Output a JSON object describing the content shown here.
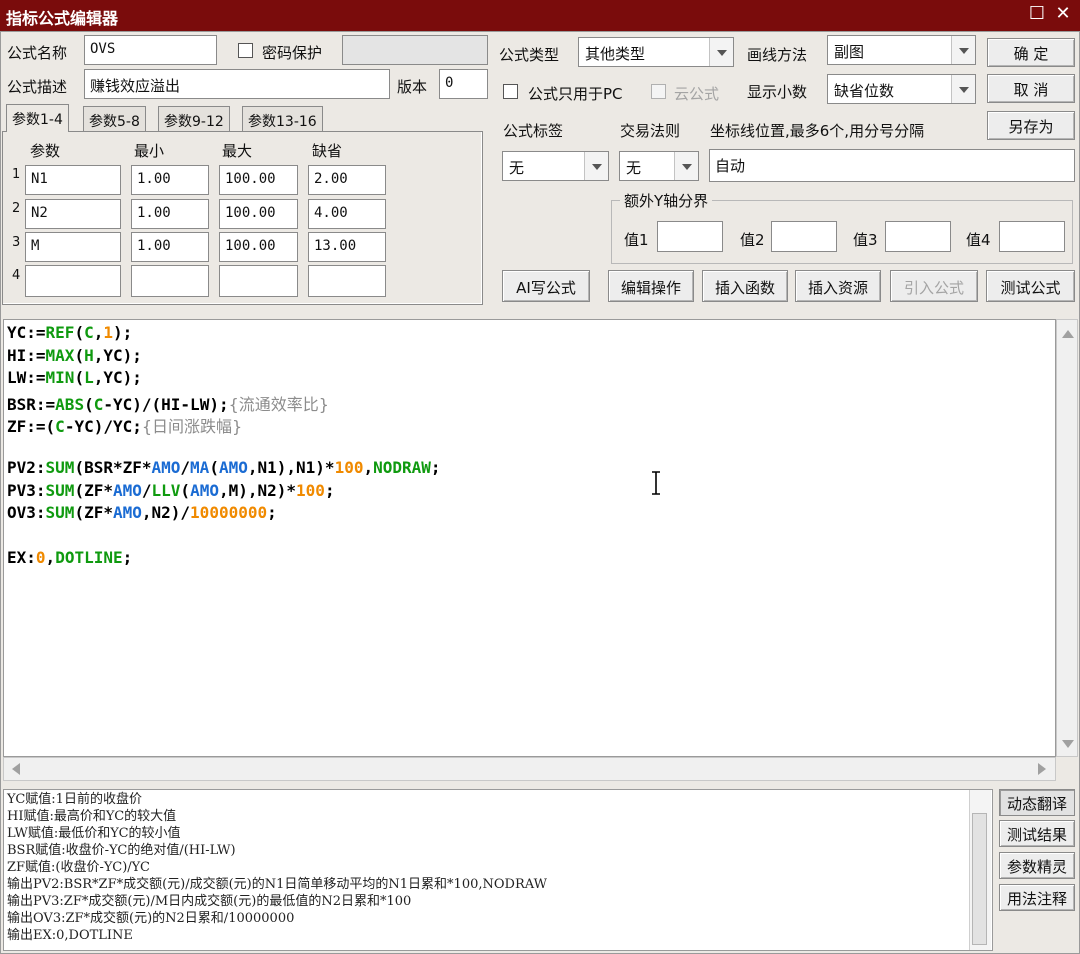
{
  "window": {
    "title": "指标公式编辑器",
    "restore_glyph": "☐",
    "close_glyph": "✕"
  },
  "form": {
    "name_label": "公式名称",
    "name_value": "OVS",
    "password_label": "密码保护",
    "desc_label": "公式描述",
    "desc_value": "赚钱效应溢出",
    "version_label": "版本",
    "version_value": "0",
    "type_label": "公式类型",
    "type_value": "其他类型",
    "draw_label": "画线方法",
    "draw_value": "副图",
    "pc_only_label": "公式只用于PC",
    "cloud_label": "云公式",
    "decimals_label": "显示小数",
    "decimals_value": "缺省位数",
    "tag_label": "公式标签",
    "tag_value": "无",
    "rule_label": "交易法则",
    "rule_value": "无",
    "axis_label": "坐标线位置,最多6个,用分号分隔",
    "axis_value": "自动",
    "extra_y_title": "额外Y轴分界",
    "val1_label": "值1",
    "val2_label": "值2",
    "val3_label": "值3",
    "val4_label": "值4"
  },
  "buttons": {
    "ok": "确  定",
    "cancel": "取  消",
    "save_as": "另存为",
    "ai": "AI写公式",
    "edit_ops": "编辑操作",
    "insert_fn": "插入函数",
    "insert_res": "插入资源",
    "import": "引入公式",
    "test": "测试公式"
  },
  "tabs": [
    "参数1-4",
    "参数5-8",
    "参数9-12",
    "参数13-16"
  ],
  "params": {
    "headers": [
      "参数",
      "最小",
      "最大",
      "缺省"
    ],
    "rows": [
      {
        "idx": "1",
        "name": "N1",
        "min": "1.00",
        "max": "100.00",
        "def": "2.00"
      },
      {
        "idx": "2",
        "name": "N2",
        "min": "1.00",
        "max": "100.00",
        "def": "4.00"
      },
      {
        "idx": "3",
        "name": "M",
        "min": "1.00",
        "max": "100.00",
        "def": "13.00"
      },
      {
        "idx": "4",
        "name": "",
        "min": "",
        "max": "",
        "def": ""
      }
    ]
  },
  "code": [
    [
      [
        "YC:=",
        ""
      ],
      [
        "REF",
        "g"
      ],
      [
        "(",
        ""
      ],
      [
        "C",
        "g"
      ],
      [
        ",",
        ""
      ],
      [
        "1",
        "o"
      ],
      [
        ");",
        ""
      ]
    ],
    [
      [
        "HI:=",
        ""
      ],
      [
        "MAX",
        "g"
      ],
      [
        "(",
        ""
      ],
      [
        "H",
        "g"
      ],
      [
        ",YC);",
        ""
      ]
    ],
    [
      [
        "LW:=",
        ""
      ],
      [
        "MIN",
        "g"
      ],
      [
        "(",
        ""
      ],
      [
        "L",
        "g"
      ],
      [
        ",YC);",
        ""
      ]
    ],
    [
      [
        "BSR:=",
        ""
      ],
      [
        "ABS",
        "g"
      ],
      [
        "(",
        ""
      ],
      [
        "C",
        "g"
      ],
      [
        "-YC)/(HI-LW);",
        ""
      ],
      [
        "{流通效率比}",
        "c"
      ]
    ],
    [
      [
        "ZF:=(",
        ""
      ],
      [
        "C",
        "g"
      ],
      [
        "-YC)/YC;",
        ""
      ],
      [
        "{日间涨跌幅}",
        "c"
      ]
    ],
    [],
    [
      [
        "PV2:",
        ""
      ],
      [
        "SUM",
        "g"
      ],
      [
        "(BSR*ZF*",
        ""
      ],
      [
        "AMO",
        "b"
      ],
      [
        "/",
        ""
      ],
      [
        "MA",
        "b"
      ],
      [
        "(",
        ""
      ],
      [
        "AMO",
        "b"
      ],
      [
        ",N1),N1)*",
        ""
      ],
      [
        "100",
        "o"
      ],
      [
        ",",
        ""
      ],
      [
        "NODRAW",
        "g"
      ],
      [
        ";",
        ""
      ]
    ],
    [
      [
        "PV3:",
        ""
      ],
      [
        "SUM",
        "g"
      ],
      [
        "(ZF*",
        ""
      ],
      [
        "AMO",
        "b"
      ],
      [
        "/",
        ""
      ],
      [
        "LLV",
        "g"
      ],
      [
        "(",
        ""
      ],
      [
        "AMO",
        "b"
      ],
      [
        ",M),N2)*",
        ""
      ],
      [
        "100",
        "o"
      ],
      [
        ";",
        ""
      ]
    ],
    [
      [
        "OV3:",
        ""
      ],
      [
        "SUM",
        "g"
      ],
      [
        "(ZF*",
        ""
      ],
      [
        "AMO",
        "b"
      ],
      [
        ",N2)/",
        ""
      ],
      [
        "10000000",
        "o"
      ],
      [
        ";",
        ""
      ]
    ],
    [],
    [
      [
        "EX:",
        ""
      ],
      [
        "0",
        "o"
      ],
      [
        ",",
        ""
      ],
      [
        "DOTLINE",
        "g"
      ],
      [
        ";",
        ""
      ]
    ]
  ],
  "output_lines": [
    "YC赋值:1日前的收盘价",
    "HI赋值:最高价和YC的较大值",
    "LW赋值:最低价和YC的较小值",
    "BSR赋值:收盘价-YC的绝对值/(HI-LW)",
    "ZF赋值:(收盘价-YC)/YC",
    "输出PV2:BSR*ZF*成交额(元)/成交额(元)的N1日简单移动平均的N1日累和*100,NODRAW",
    "输出PV3:ZF*成交额(元)/M日内成交额(元)的最低值的N2日累和*100",
    "输出OV3:ZF*成交额(元)的N2日累和/10000000",
    "输出EX:0,DOTLINE"
  ],
  "side_buttons": [
    "动态翻译",
    "测试结果",
    "参数精灵",
    "用法注释"
  ],
  "colors": {
    "title_bar": "#7a0c0c",
    "function": "#0f9a0f",
    "variable": "#1a6bd3",
    "number": "#f08a00",
    "comment": "#8c8c8c"
  }
}
